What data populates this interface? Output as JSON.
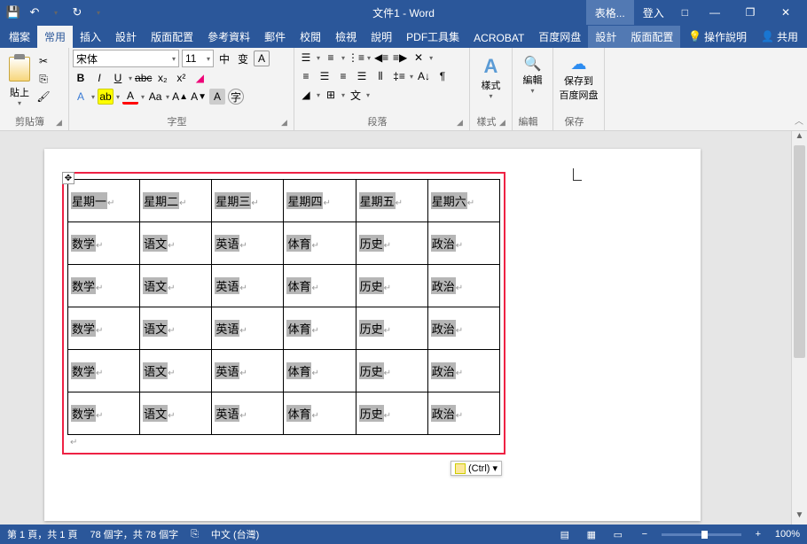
{
  "title": "文件1 - Word",
  "qat": {
    "save": "💾",
    "undo": "↶",
    "redo": "↻",
    "more": "▾"
  },
  "title_right": {
    "table_tools": "表格...",
    "login": "登入",
    "window": "□"
  },
  "win": {
    "min": "—",
    "max": "❐",
    "close": "✕"
  },
  "tabs": {
    "file": "檔案",
    "home": "常用",
    "insert": "插入",
    "design": "設計",
    "layout": "版面配置",
    "references": "參考資料",
    "mailings": "郵件",
    "review": "校閱",
    "view": "檢視",
    "help": "說明",
    "pdf": "PDF工具集",
    "acrobat": "ACROBAT",
    "baidu": "百度网盘",
    "tt_design": "設計",
    "tt_layout": "版面配置"
  },
  "tab_right": {
    "tell_me": "操作說明",
    "share": "共用"
  },
  "ribbon": {
    "clipboard": {
      "paste": "貼上",
      "label": "剪貼簿"
    },
    "font": {
      "name": "宋体",
      "size": "11",
      "label": "字型",
      "bold": "B",
      "italic": "I",
      "underline": "U",
      "strike": "abc",
      "sub": "x₂",
      "sup": "x²"
    },
    "paragraph": {
      "label": "段落"
    },
    "styles": {
      "label": "樣式",
      "btn": "樣式"
    },
    "editing": {
      "label": "編輯",
      "btn": "編輯"
    },
    "save": {
      "label": "保存",
      "btn1": "保存到",
      "btn2": "百度网盘"
    }
  },
  "table": {
    "headers": [
      "星期一",
      "星期二",
      "星期三",
      "星期四",
      "星期五",
      "星期六"
    ],
    "rows": [
      [
        "数学",
        "语文",
        "英语",
        "体育",
        "历史",
        "政治"
      ],
      [
        "数学",
        "语文",
        "英语",
        "体育",
        "历史",
        "政治"
      ],
      [
        "数学",
        "语文",
        "英语",
        "体育",
        "历史",
        "政治"
      ],
      [
        "数学",
        "语文",
        "英语",
        "体育",
        "历史",
        "政治"
      ],
      [
        "数学",
        "语文",
        "英语",
        "体育",
        "历史",
        "政治"
      ]
    ]
  },
  "paste_opt": "(Ctrl) ▾",
  "status": {
    "page": "第 1 頁，共 1 頁",
    "words": "78 個字，共 78 個字",
    "lang": "中文 (台灣)",
    "zoom": "100%"
  }
}
